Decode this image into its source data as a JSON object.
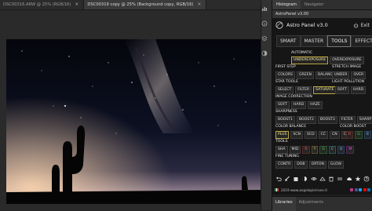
{
  "document_tabs": [
    {
      "label": "DSC00316.ARW @ 25% (RGB/16)",
      "close": "×",
      "active": false
    },
    {
      "label": "DSC00319 copy @ 25% (Background copy, RGB/16)",
      "close": "×",
      "active": true
    }
  ],
  "panel_tabs": [
    "Histogram",
    "Navigator"
  ],
  "plugin_tab": "AstroPanel v3.00",
  "plugin": {
    "title": "Astro Panel v3.0",
    "exit": "Exit",
    "main_tabs": [
      "SMART",
      "MASTER",
      "TOOLS",
      "EFFECTS"
    ],
    "automatic": {
      "label": "AUTOMATIC",
      "buttons": [
        "UNDEREXPOSURE",
        "OVEREXPOSURE"
      ]
    },
    "first_step": {
      "label": "FIRST STEP",
      "buttons": [
        "COLORS",
        "GREEN",
        "BALANCE"
      ]
    },
    "stretch_image": {
      "label": "STRETCH IMAGE",
      "buttons": [
        "UNDER",
        "OVER"
      ]
    },
    "star_tools": {
      "label": "STAR TOOLS",
      "buttons": [
        "SELECT",
        "FILTER",
        "SATURATE"
      ]
    },
    "light_pollution": {
      "label": "LIGHT POLLUTION",
      "buttons": [
        "SOFT",
        "HARD"
      ]
    },
    "image_correction": {
      "label": "IMAGE CORRECTION",
      "buttons": [
        "SOFT",
        "HARD",
        "HAZE"
      ]
    },
    "sharpness": {
      "label": "SHARPNESS",
      "buttons": [
        "BOOST1",
        "BOOST2",
        "BOOST3",
        "FILTER",
        "SHARP"
      ]
    },
    "color_balance": {
      "label": "COLOR BALANCE",
      "buttons": [
        "PLUS",
        "SCN",
        "SCD",
        "CC",
        "CN",
        "CD"
      ]
    },
    "color_boost": {
      "label": "COLOR BOOST",
      "buttons": [
        "R",
        "G",
        "B"
      ]
    },
    "tools": {
      "label": "TOOLS",
      "buttons": [
        "SHA",
        "MID",
        "R",
        "Y",
        "G",
        "C",
        "B",
        "M"
      ]
    },
    "fine_tuning": {
      "label": "FINE TUNING",
      "buttons": [
        "CONTR",
        "DOB",
        "ORTON",
        "GLOW"
      ]
    },
    "website": "2019 www.angelopierrone.it",
    "colors": {
      "accent": "#bba640",
      "bg": "#161616"
    }
  },
  "bottom_tabs": [
    "Libraries",
    "Adjustments"
  ]
}
